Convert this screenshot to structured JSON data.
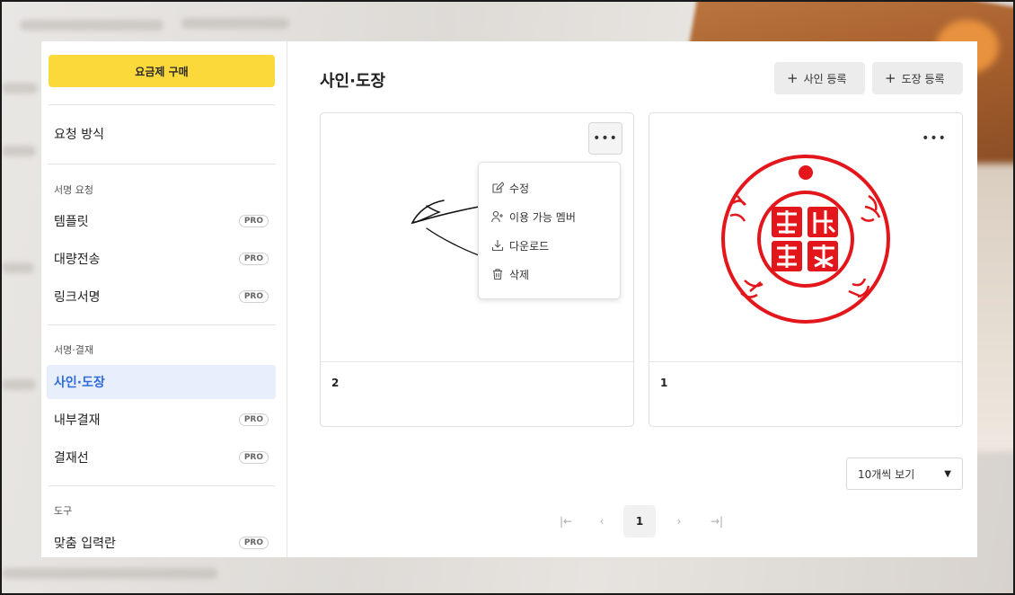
{
  "sidebar": {
    "plan_button": "요금제 구매",
    "request_method": "요청 방식",
    "sections": [
      {
        "label": "서명 요청",
        "items": [
          {
            "label": "템플릿",
            "badge": "PRO"
          },
          {
            "label": "대량전송",
            "badge": "PRO"
          },
          {
            "label": "링크서명",
            "badge": "PRO"
          }
        ]
      },
      {
        "label": "서명·결재",
        "items": [
          {
            "label": "사인·도장",
            "badge": ""
          },
          {
            "label": "내부결재",
            "badge": "PRO"
          },
          {
            "label": "결재선",
            "badge": "PRO"
          }
        ]
      },
      {
        "label": "도구",
        "items": [
          {
            "label": "맞춤 입력란",
            "badge": "PRO"
          }
        ]
      }
    ],
    "active_item": "사인·도장"
  },
  "main": {
    "title": "사인·도장",
    "buttons": {
      "add_signature": "사인 등록",
      "add_stamp": "도장 등록"
    },
    "cards": [
      {
        "name": "2",
        "type": "signature",
        "menu_open": true
      },
      {
        "name": "1",
        "type": "stamp",
        "menu_open": false
      }
    ],
    "context_menu": [
      {
        "label": "수정",
        "icon": "edit-icon"
      },
      {
        "label": "이용 가능 멤버",
        "icon": "add-member-icon"
      },
      {
        "label": "다운로드",
        "icon": "download-icon"
      },
      {
        "label": "삭제",
        "icon": "trash-icon"
      }
    ],
    "page_size": "10개씩 보기",
    "pagination": {
      "current": "1"
    }
  },
  "colors": {
    "accent": "#fbd93a",
    "active": "#2f6bdb",
    "stamp": "#e3161b"
  }
}
